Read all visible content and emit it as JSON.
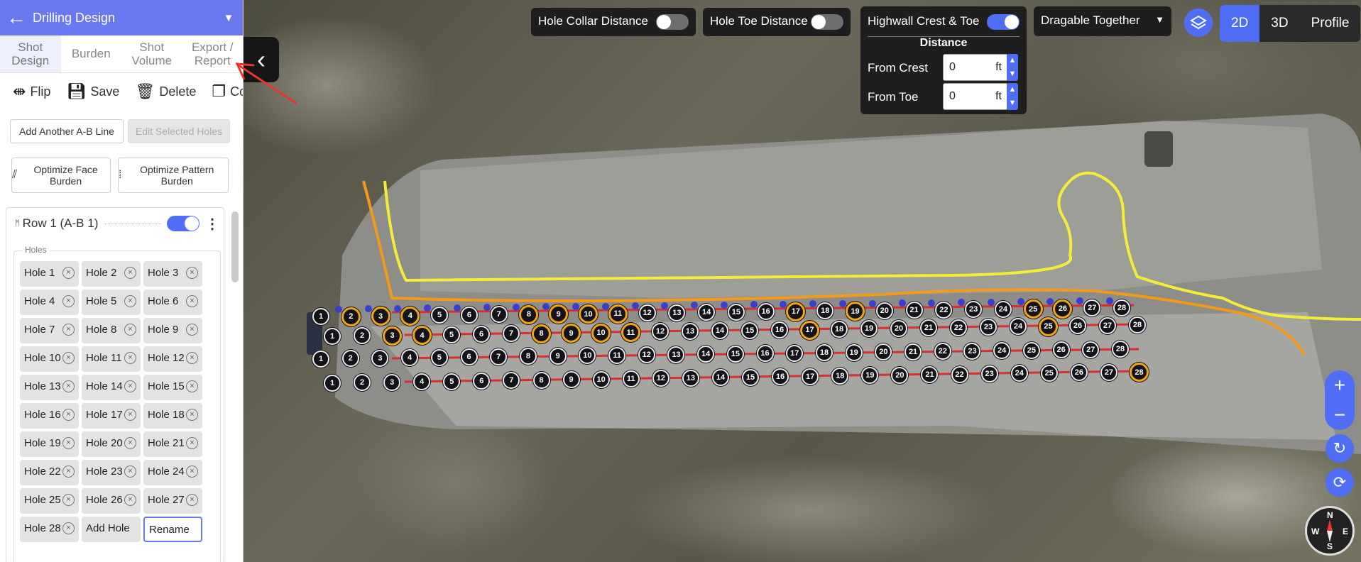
{
  "sidebar": {
    "title": "Drilling Design",
    "tabs": [
      {
        "label": "Shot Design",
        "active": true
      },
      {
        "label": "Burden",
        "active": false
      },
      {
        "label": "Shot Volume",
        "active": false
      },
      {
        "label": "Export / Report",
        "active": false
      }
    ],
    "actions": [
      {
        "label": "Flip",
        "icon": "flip-icon"
      },
      {
        "label": "Save",
        "icon": "save-icon"
      },
      {
        "label": "Delete",
        "icon": "trash-icon"
      },
      {
        "label": "Copy",
        "icon": "copy-icon"
      }
    ],
    "add_line_label": "Add Another A-B Line",
    "edit_selected_label": "Edit Selected Holes",
    "optimize_face_label": "Optimize Face Burden",
    "optimize_pattern_label": "Optimize Pattern Burden",
    "row": {
      "title": "Row 1 (A-B 1)",
      "enabled": true,
      "holes_legend": "Holes",
      "holes": [
        "Hole 1",
        "Hole 2",
        "Hole 3",
        "Hole 4",
        "Hole 5",
        "Hole 6",
        "Hole 7",
        "Hole 8",
        "Hole 9",
        "Hole 10",
        "Hole 11",
        "Hole 12",
        "Hole 13",
        "Hole 14",
        "Hole 15",
        "Hole 16",
        "Hole 17",
        "Hole 18",
        "Hole 19",
        "Hole 20",
        "Hole 21",
        "Hole 22",
        "Hole 23",
        "Hole 24",
        "Hole 25",
        "Hole 26",
        "Hole 27",
        "Hole 28"
      ],
      "add_hole_label": "Add Hole",
      "rename_label": "Rename"
    }
  },
  "toolbar": {
    "hole_collar_label": "Hole Collar Distance",
    "hole_collar_on": false,
    "hole_toe_label": "Hole Toe Distance",
    "hole_toe_on": false,
    "highwall_label": "Highwall Crest & Toe",
    "highwall_on": true,
    "distance_title": "Distance",
    "from_crest_label": "From Crest",
    "from_crest_value": "0",
    "from_toe_label": "From Toe",
    "from_toe_value": "0",
    "unit": "ft",
    "drag_mode": "Dragable Together",
    "views": [
      "2D",
      "3D",
      "Profile"
    ],
    "active_view": "2D"
  },
  "map_controls": {
    "zoom_in": "+",
    "zoom_out": "−",
    "compass_letters": [
      "N",
      "E",
      "S",
      "W"
    ]
  },
  "holes_rows": [
    {
      "labels": [
        "1",
        "2",
        "3",
        "4",
        "5",
        "6",
        "7",
        "8",
        "9",
        "10",
        "11",
        "12",
        "13",
        "14",
        "15",
        "16",
        "17",
        "18",
        "19",
        "20",
        "21",
        "22",
        "23",
        "24",
        "25",
        "26",
        "27",
        "28"
      ]
    },
    {
      "labels": [
        "1",
        "2",
        "3",
        "4",
        "5",
        "6",
        "7",
        "8",
        "9",
        "10",
        "11",
        "12",
        "13",
        "14",
        "15",
        "16",
        "17",
        "18",
        "19",
        "20",
        "21",
        "22",
        "23",
        "24",
        "25",
        "26",
        "27",
        "28"
      ]
    },
    {
      "labels": [
        "1",
        "2",
        "3",
        "4",
        "5",
        "6",
        "7",
        "8",
        "9",
        "10",
        "11",
        "12",
        "13",
        "14",
        "15",
        "16",
        "17",
        "18",
        "19",
        "20",
        "21",
        "22",
        "23",
        "24",
        "25",
        "26",
        "27",
        "28"
      ]
    },
    {
      "labels": [
        "1",
        "2",
        "3",
        "4",
        "5",
        "6",
        "7",
        "8",
        "9",
        "10",
        "11",
        "12",
        "13",
        "14",
        "15",
        "16",
        "17",
        "18",
        "19",
        "20",
        "21",
        "22",
        "23",
        "24",
        "25",
        "26",
        "27",
        "28"
      ]
    }
  ],
  "colors": {
    "accent": "#4f6df5",
    "header": "#6a79f0",
    "crest_line": "#f5ec3a",
    "toe_line": "#f39a1a",
    "row_line": "#d9302f"
  }
}
